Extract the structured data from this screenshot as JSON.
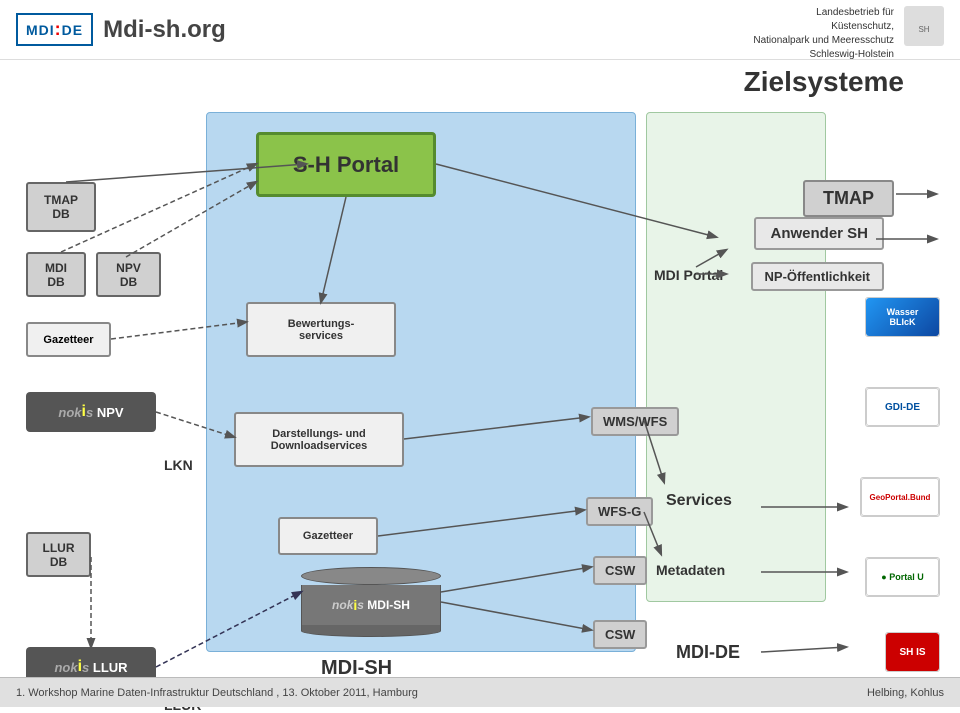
{
  "header": {
    "logo_text": "MDI:DE",
    "site_title": "Mdi-sh.org",
    "org_line1": "Landesbetrieb für",
    "org_line2": "Küstenschutz,",
    "org_line3": "Nationalpark und Meeresschutz",
    "org_line4": "Schleswig-Holstein"
  },
  "main_title": "Zielsysteme",
  "boxes": {
    "tmap_db": "TMAP\nDB",
    "mdi_db": "MDI\nDB",
    "npv_db": "NPV\nDB",
    "llur_db": "LLUR\nDB",
    "sh_portal": "S-H Portal",
    "bewertungsservices": "Bewertungs-\nservices",
    "darstellung": "Darstellungs- und\nDownloadservices",
    "gazetteer_blue": "Gazetteer",
    "gazetteer_left": "Gazetteer",
    "nokis_npv": "nokis NPV",
    "nokis_llur": "nokis LLUR",
    "nokis_mdish": "nokis MDI-SH",
    "mdi_portal": "MDI Portal",
    "anwender_sh": "Anwender SH",
    "np_offentlichkeit": "NP-Öffentlichkeit",
    "tmap_right": "TMAP",
    "wms_wfs": "WMS/WFS",
    "wfs_g": "WFS-G",
    "csw_top": "CSW",
    "csw_bottom": "CSW",
    "services": "Services",
    "metadaten": "Metadaten",
    "mdi_de": "MDI-DE",
    "mdi_sh_label": "MDI-SH",
    "lkn": "LKN",
    "llur_right": "LLUR"
  },
  "footer": {
    "workshop_text": "1. Workshop Marine Daten-Infrastruktur Deutschland , 13. Oktober 2011, Hamburg",
    "author": "Helbing, Kohlus"
  },
  "logos": {
    "wasser_blick": "Wasser\nBLIcK",
    "gdi_de": "GDI-DE",
    "geoportal_bund": "GeoPortal.Bund",
    "portal_u": "Portal U",
    "sh_is": "SH IS"
  }
}
